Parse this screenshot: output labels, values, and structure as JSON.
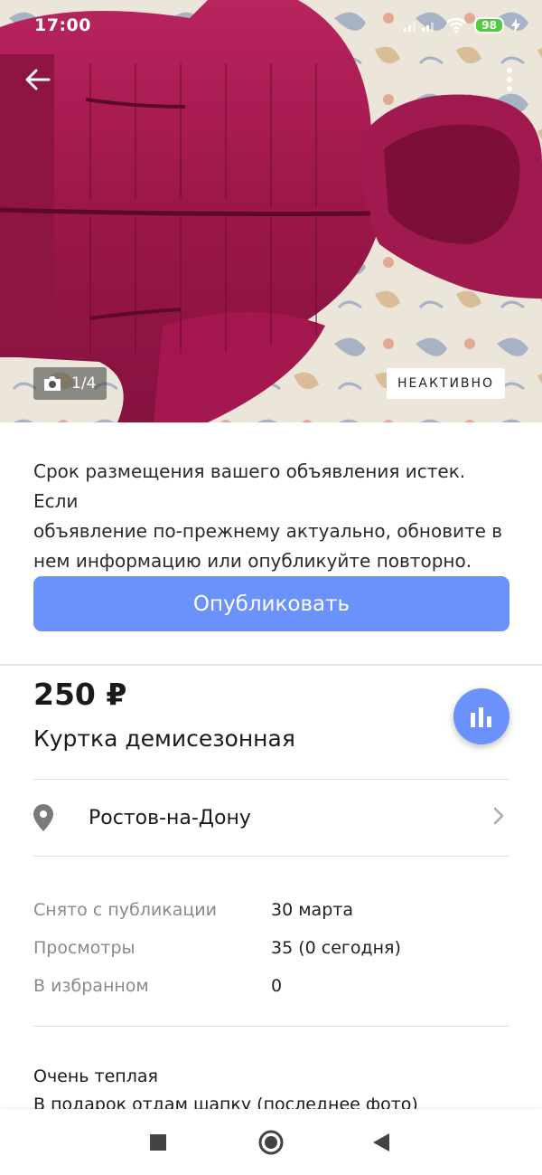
{
  "status_bar": {
    "time": "17:00",
    "battery": "98"
  },
  "photo": {
    "counter": "1/4",
    "status_badge": "НЕАКТИВНО"
  },
  "notice": {
    "line1": "Срок размещения вашего объявления истек. Если",
    "line2": "объявление по-прежнему актуально, обновите в",
    "line3": "нем информацию или опубликуйте повторно."
  },
  "publish_button": {
    "label": "Опубликовать"
  },
  "ad": {
    "price": "250 ₽",
    "title": "Куртка демисезонная",
    "location": "Ростов-на-Дону"
  },
  "stats": [
    {
      "label": "Снято с публикации",
      "value": "30 марта"
    },
    {
      "label": "Просмотры",
      "value": "35 (0 сегодня)"
    },
    {
      "label": "В избранном",
      "value": "0"
    }
  ],
  "description": {
    "line1": "Очень теплая",
    "line2": "В подарок отдам шапку (последнее фото)"
  },
  "colors": {
    "accent": "#6b92fb",
    "jacket": "#a3174f",
    "badge_bg": "#ffffff"
  },
  "icons": [
    "back-arrow-icon",
    "more-vert-icon",
    "camera-icon",
    "stats-icon",
    "location-pin-icon",
    "chevron-right-icon",
    "nav-recents-icon",
    "nav-home-icon",
    "nav-back-icon"
  ]
}
